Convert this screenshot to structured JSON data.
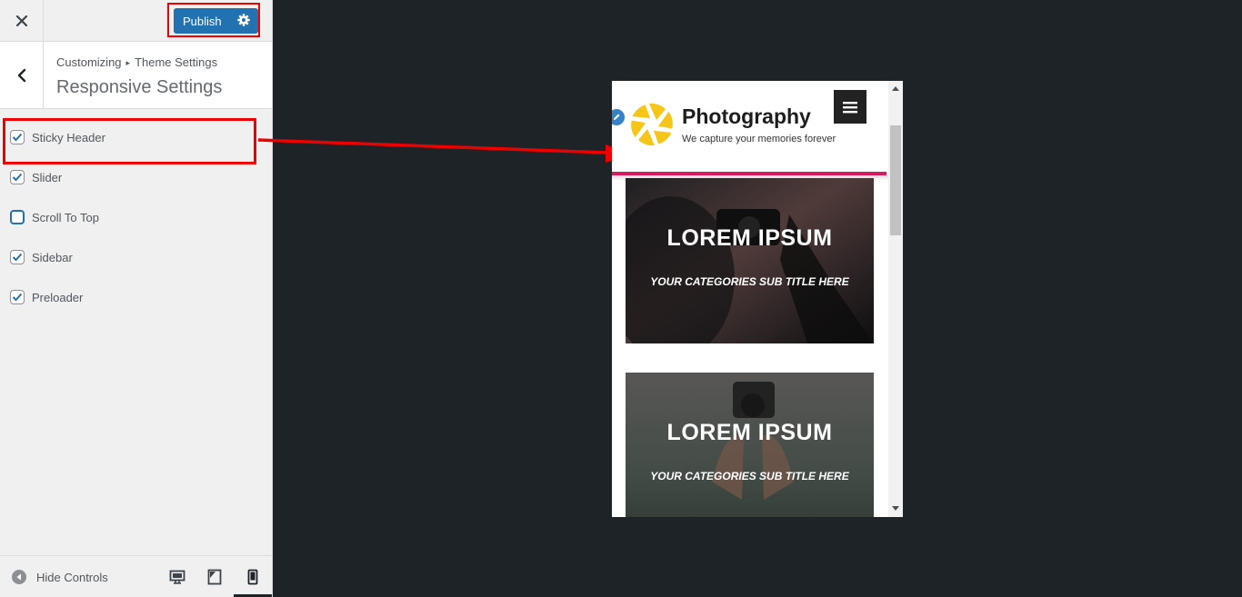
{
  "customizer": {
    "publish_label": "Publish",
    "breadcrumb": {
      "root": "Customizing",
      "parent": "Theme Settings"
    },
    "section_title": "Responsive Settings",
    "options": [
      {
        "label": "Sticky Header",
        "checked": true
      },
      {
        "label": "Slider",
        "checked": true
      },
      {
        "label": "Scroll To Top",
        "checked": false
      },
      {
        "label": "Sidebar",
        "checked": true
      },
      {
        "label": "Preloader",
        "checked": true
      }
    ],
    "footer": {
      "hide_controls_label": "Hide Controls",
      "active_device": "mobile"
    }
  },
  "preview": {
    "site_title": "Photography",
    "tagline": "We capture your memories forever",
    "cards": [
      {
        "title": "LOREM IPSUM",
        "subtitle": "YOUR CATEGORIES SUB TITLE HERE"
      },
      {
        "title": "LOREM IPSUM",
        "subtitle": "YOUR CATEGORIES SUB TITLE HERE"
      }
    ]
  },
  "colors": {
    "publish": "#2271b1",
    "highlight": "#ee0000",
    "header_accent": "#d81b60",
    "logo_yellow": "#f5c518",
    "background": "#1d2327"
  },
  "icons": [
    "close-icon",
    "gear-icon",
    "chevron-left-icon",
    "checkmark-icon",
    "hide-controls-icon",
    "desktop-icon",
    "tablet-icon",
    "mobile-icon",
    "hamburger-icon",
    "pencil-icon",
    "camera-aperture-logo"
  ]
}
